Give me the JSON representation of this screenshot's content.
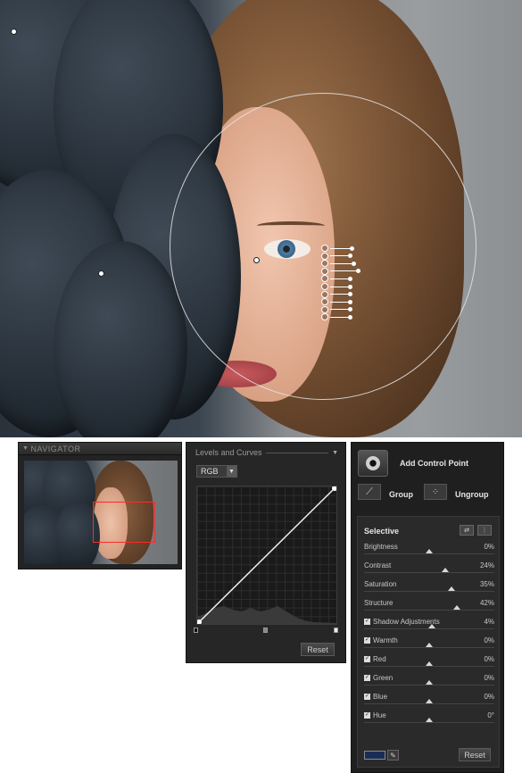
{
  "navigator": {
    "title": "NAVIGATOR"
  },
  "levels": {
    "title": "Levels and Curves",
    "channel": "RGB",
    "reset_label": "Reset"
  },
  "control_points": {
    "add_label": "Add Control Point",
    "group_label": "Group",
    "ungroup_label": "Ungroup",
    "selective_title": "Selective",
    "reset_label": "Reset",
    "swatch_color": "#1b2d55",
    "adjustments": [
      {
        "label": "Brightness",
        "value": "0%",
        "checkbox": false,
        "level": 0.5
      },
      {
        "label": "Contrast",
        "value": "24%",
        "checkbox": false,
        "level": 0.62
      },
      {
        "label": "Saturation",
        "value": "35%",
        "checkbox": false,
        "level": 0.67
      },
      {
        "label": "Structure",
        "value": "42%",
        "checkbox": false,
        "level": 0.71
      },
      {
        "label": "Shadow Adjustments",
        "value": "4%",
        "checkbox": true,
        "level": 0.52
      },
      {
        "label": "Warmth",
        "value": "0%",
        "checkbox": true,
        "level": 0.5
      },
      {
        "label": "Red",
        "value": "0%",
        "checkbox": true,
        "level": 0.5
      },
      {
        "label": "Green",
        "value": "0%",
        "checkbox": true,
        "level": 0.5
      },
      {
        "label": "Blue",
        "value": "0%",
        "checkbox": true,
        "level": 0.5
      },
      {
        "label": "Hue",
        "value": "0°",
        "checkbox": true,
        "level": 0.5
      }
    ]
  },
  "photo_overlay": {
    "control_point_count": 1,
    "slider_levels": [
      0.55,
      0.5,
      0.6,
      0.7,
      0.5,
      0.5,
      0.5,
      0.5,
      0.5,
      0.5
    ]
  }
}
